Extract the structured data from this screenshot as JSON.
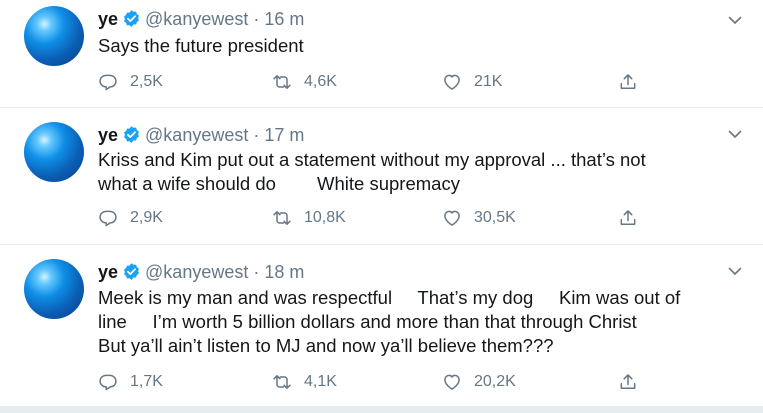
{
  "tweets": [
    {
      "name": "ye",
      "handle": "@kanyewest",
      "separator": "·",
      "time": "16 m",
      "lines": [
        "Says the future president"
      ],
      "replies": "2,5K",
      "retweets": "4,6K",
      "likes": "21K"
    },
    {
      "name": "ye",
      "handle": "@kanyewest",
      "separator": "·",
      "time": "17 m",
      "lines": [
        "Kriss and Kim put out a statement without my approval ... that’s not",
        "what a wife should do        White supremacy"
      ],
      "replies": "2,9K",
      "retweets": "10,8K",
      "likes": "30,5K"
    },
    {
      "name": "ye",
      "handle": "@kanyewest",
      "separator": "·",
      "time": "18 m",
      "lines": [
        "Meek is my man and was respectful     That’s my dog     Kim was out of",
        "line     I’m worth 5 billion dollars and more than that through Christ",
        "But ya’ll ain’t listen to MJ and now ya’ll believe them???"
      ],
      "replies": "1,7K",
      "retweets": "4,1K",
      "likes": "20,2K"
    }
  ],
  "icons": {
    "verified": "verified-badge-icon",
    "chevron": "chevron-down-icon",
    "reply": "reply-icon",
    "retweet": "retweet-icon",
    "like": "heart-icon",
    "share": "share-icon"
  },
  "colors": {
    "accent": "#1da1f2",
    "text": "#14171a",
    "muted": "#657786",
    "border": "#e6ecf0"
  }
}
